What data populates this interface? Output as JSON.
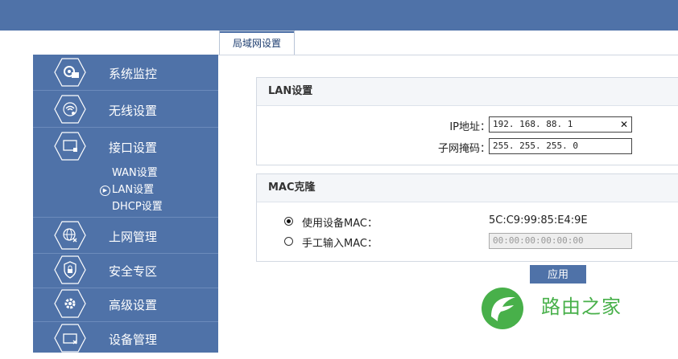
{
  "tabs": [
    {
      "label": "局域网设置",
      "active": true
    }
  ],
  "sidebar": {
    "items": [
      {
        "label": "系统监控",
        "icon": "system-monitor-icon"
      },
      {
        "label": "无线设置",
        "icon": "wireless-icon"
      },
      {
        "label": "接口设置",
        "icon": "interface-icon"
      },
      {
        "label": "上网管理",
        "icon": "internet-manage-icon"
      },
      {
        "label": "安全专区",
        "icon": "security-icon"
      },
      {
        "label": "高级设置",
        "icon": "advanced-gear-icon"
      },
      {
        "label": "设备管理",
        "icon": "device-manage-icon"
      }
    ],
    "submenu": [
      {
        "label": "WAN设置",
        "active": false
      },
      {
        "label": "LAN设置",
        "active": true
      },
      {
        "label": "DHCP设置",
        "active": false
      }
    ]
  },
  "lan": {
    "title": "LAN设置",
    "ip_label": "IP地址：",
    "ip_value": "192. 168. 88. 1",
    "mask_label": "子网掩码：",
    "mask_value": "255. 255. 255. 0"
  },
  "mac": {
    "title": "MAC克隆",
    "use_device_label": "使用设备MAC：",
    "use_device_value": "5C:C9:99:85:E4:9E",
    "manual_label": "手工输入MAC：",
    "manual_placeholder": "00:00:00:00:00:00",
    "selected": "use_device"
  },
  "apply_label": "应用",
  "watermark": {
    "text": "路由之家"
  },
  "colors": {
    "brand": "#4f72a8",
    "watermark": "#48b04a"
  }
}
